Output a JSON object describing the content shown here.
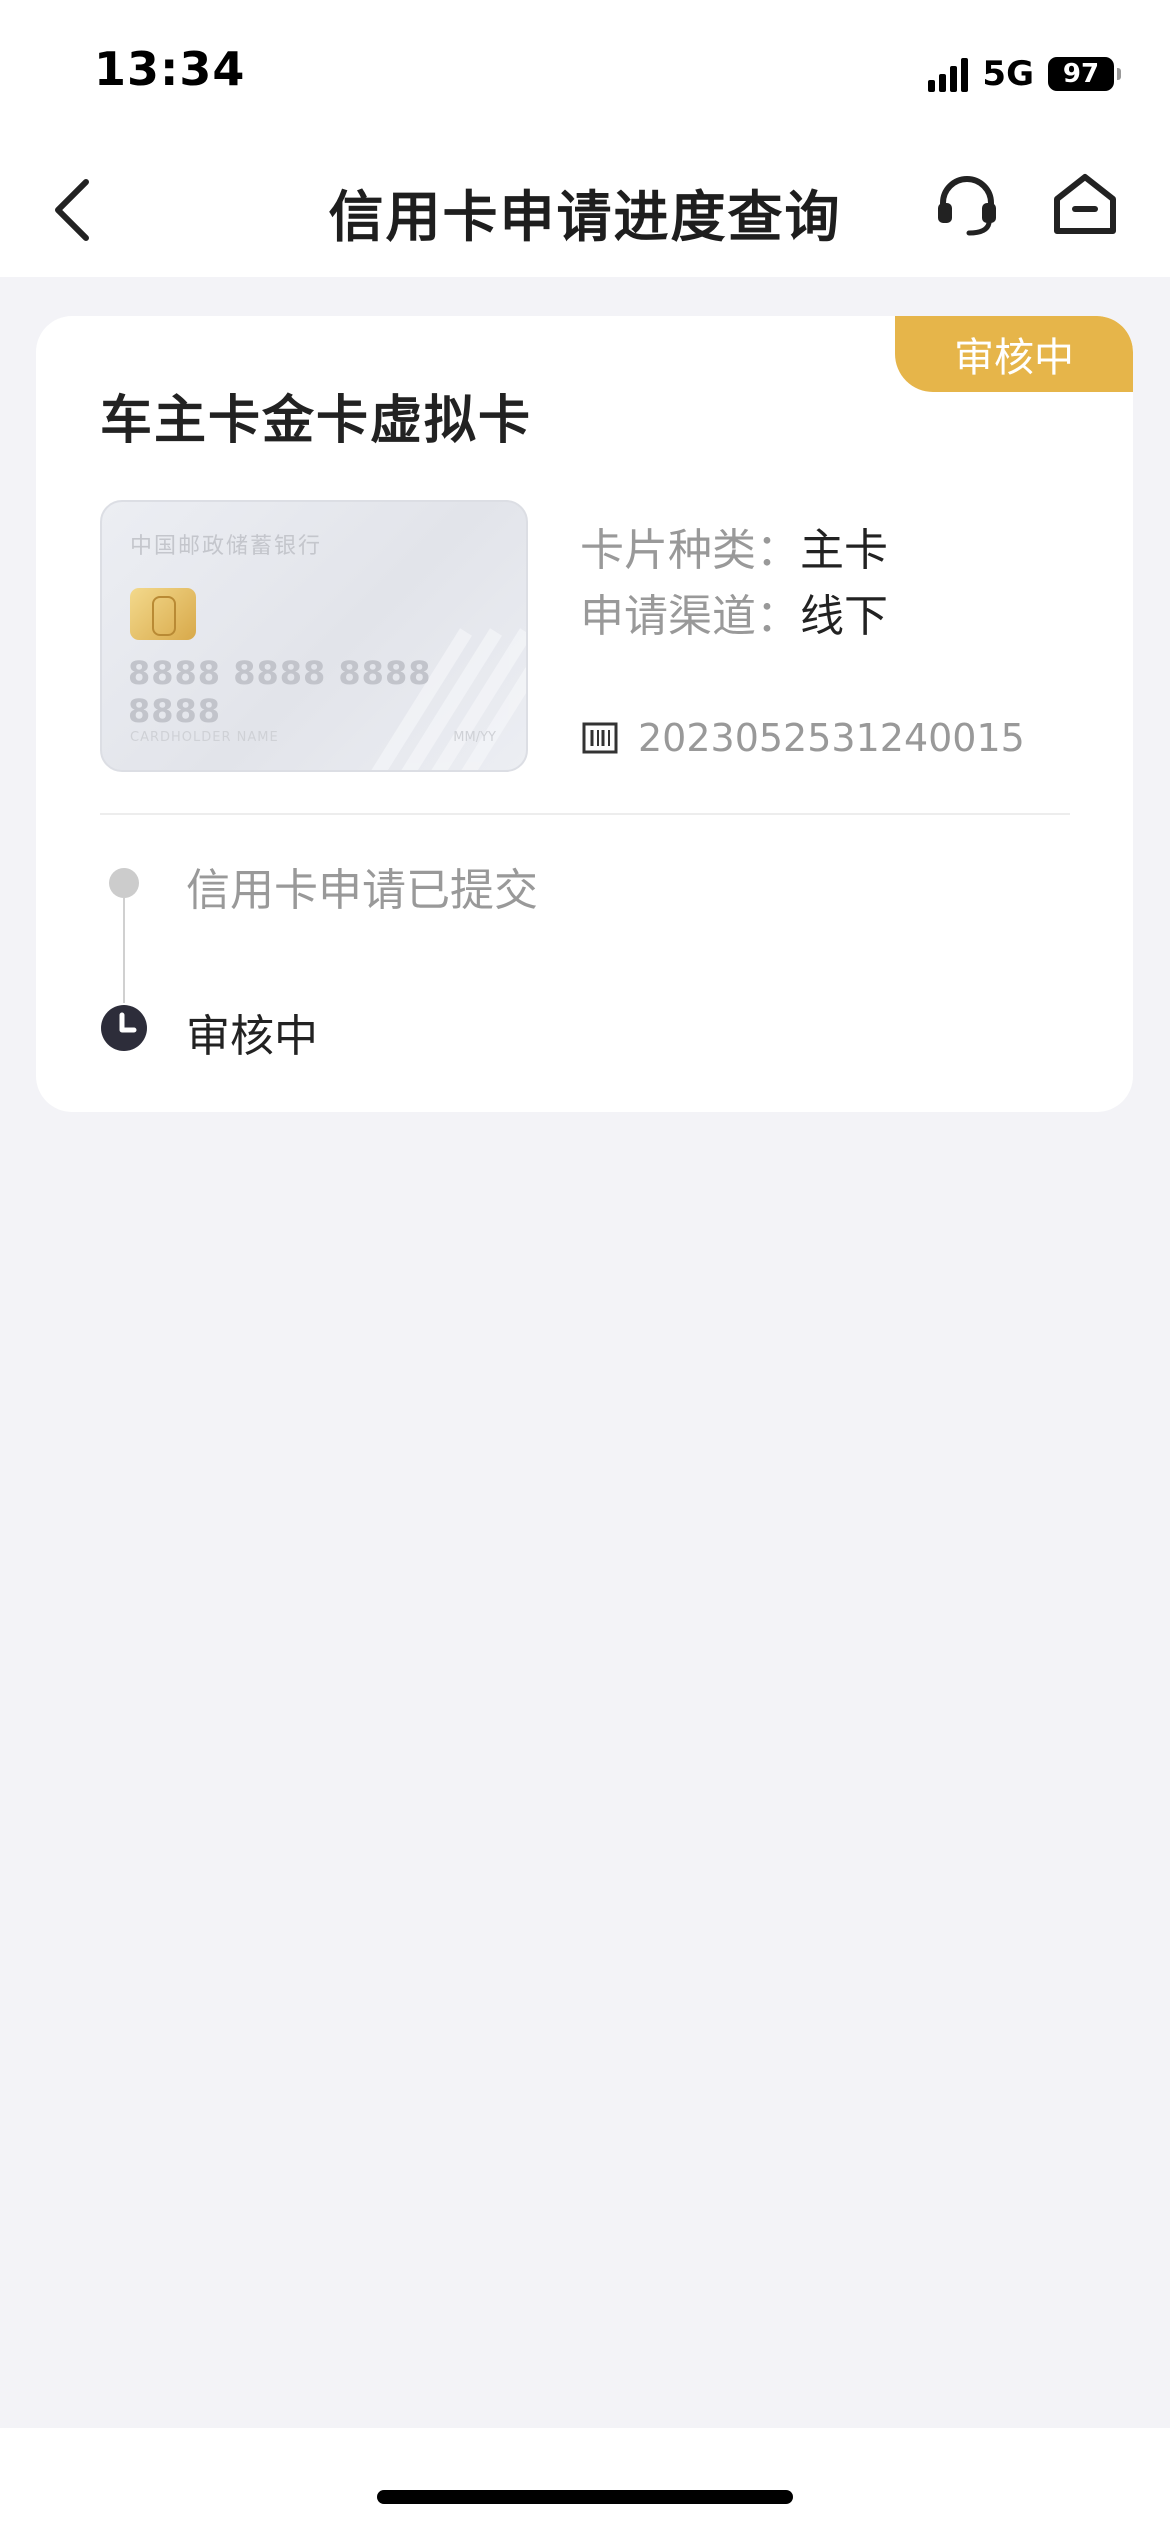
{
  "status_bar": {
    "time": "13:34",
    "network": "5G",
    "battery": "97"
  },
  "header": {
    "title": "信用卡申请进度查询",
    "back_icon": "chevron-left-icon",
    "service_icon": "headset-icon",
    "home_icon": "home-icon"
  },
  "application": {
    "status_badge": "审核中",
    "card_name": "车主卡金卡虚拟卡",
    "card_image": {
      "bank_name": "中国邮政储蓄银行",
      "number": "8888 8888 8888 8888",
      "holder": "CARDHOLDER NAME",
      "expiry": "MM/YY"
    },
    "card_type_label": "卡片种类：",
    "card_type_value": "主卡",
    "channel_label": "申请渠道：",
    "channel_value": "线下",
    "application_no": "2023052531240015",
    "badge_color": "#e6b54a"
  },
  "timeline": [
    {
      "label": "信用卡申请已提交",
      "state": "done"
    },
    {
      "label": "审核中",
      "state": "current"
    }
  ]
}
